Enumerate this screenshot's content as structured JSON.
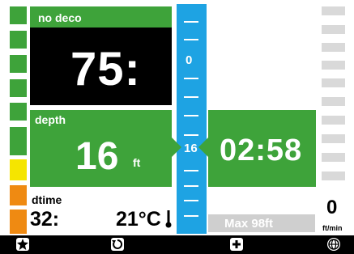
{
  "nodeco": {
    "label": "no deco",
    "value": "75:"
  },
  "depth": {
    "label": "depth",
    "value": "16",
    "unit": "ft"
  },
  "time": {
    "value": "02:58"
  },
  "scale": {
    "top_label": "0",
    "marker_label": "16"
  },
  "dtime": {
    "label": "dtime",
    "value": "32:"
  },
  "temperature": {
    "value": "21°C"
  },
  "max_depth": {
    "label": "Max 98ft"
  },
  "ascent_rate": {
    "value": "0",
    "unit": "ft/min"
  },
  "tissue_bars": [
    {
      "color": "#3ea33a"
    },
    {
      "color": "#3ea33a"
    },
    {
      "color": "#3ea33a"
    },
    {
      "color": "#3ea33a"
    },
    {
      "color": "#3ea33a"
    },
    {
      "color": "#3ea33a"
    },
    {
      "color": "#3ea33a"
    },
    {
      "color": "#f5e500"
    },
    {
      "color": "#ef8a12"
    },
    {
      "color": "#ef8a12"
    }
  ],
  "bottom_icons": [
    "star-icon",
    "refresh-icon",
    "plus-icon",
    "globe-icon"
  ],
  "colors": {
    "green": "#3ea33a",
    "black": "#000000",
    "blue": "#1ea3e3",
    "grey": "#cfcfcf",
    "yellow": "#f5e500",
    "orange": "#ef8a12"
  }
}
